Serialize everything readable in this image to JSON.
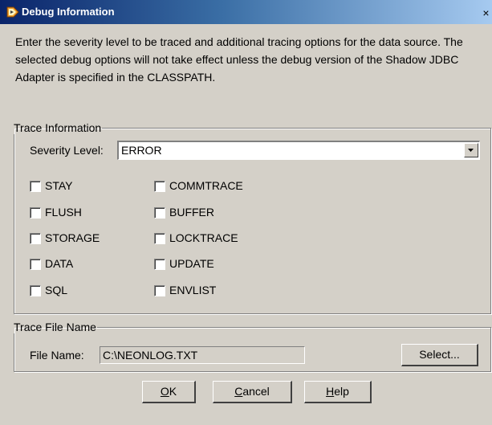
{
  "window": {
    "title": "Debug Information",
    "close_label": "×"
  },
  "description": "Enter the severity level to be traced and additional tracing options for the data source.  The selected debug options will not take effect unless the debug version of the Shadow JDBC Adapter is specified in the CLASSPATH.",
  "trace_info": {
    "legend": "Trace Information",
    "severity_label": "Severity Level:",
    "severity_value": "ERROR",
    "options_left": [
      {
        "label": "STAY",
        "checked": false
      },
      {
        "label": "FLUSH",
        "checked": false
      },
      {
        "label": "STORAGE",
        "checked": false
      },
      {
        "label": "DATA",
        "checked": false
      },
      {
        "label": "SQL",
        "checked": false
      }
    ],
    "options_right": [
      {
        "label": "COMMTRACE",
        "checked": false
      },
      {
        "label": "BUFFER",
        "checked": false
      },
      {
        "label": "LOCKTRACE",
        "checked": false
      },
      {
        "label": "UPDATE",
        "checked": false
      },
      {
        "label": "ENVLIST",
        "checked": false
      }
    ]
  },
  "trace_file": {
    "legend": "Trace File Name",
    "filename_label": "File Name:",
    "filename_value": "C:\\NEONLOG.TXT",
    "select_label": "Select..."
  },
  "buttons": {
    "ok_prefix": "O",
    "ok_rest": "K",
    "cancel_prefix": "C",
    "cancel_rest": "ancel",
    "help_prefix": "H",
    "help_rest": "elp"
  }
}
